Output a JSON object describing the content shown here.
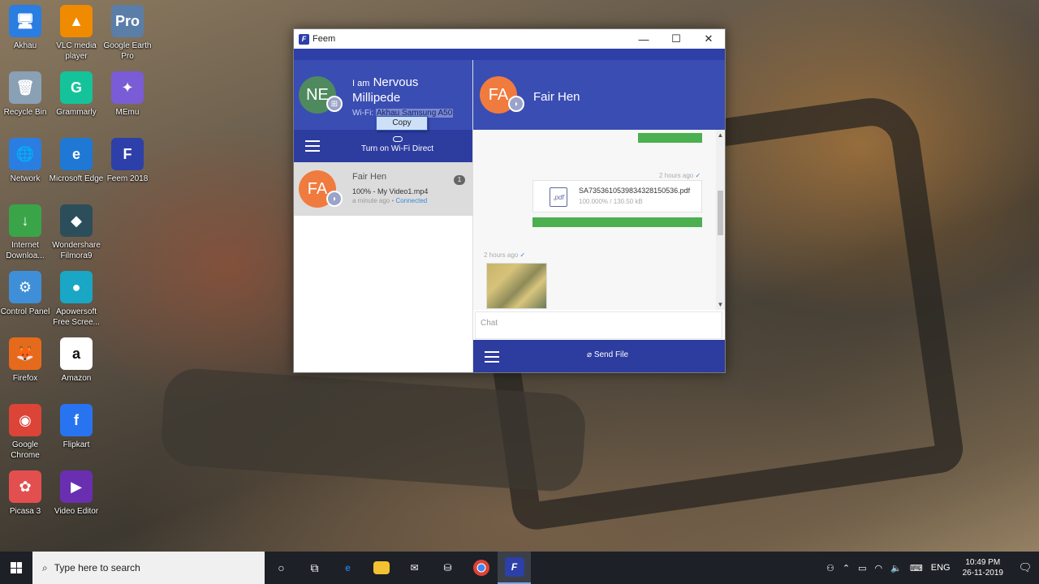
{
  "desktop": {
    "icons": [
      {
        "label": "Akhau",
        "glyph": "🖥",
        "color": "#2a7de1"
      },
      {
        "label": "VLC media player",
        "glyph": "▲",
        "color": "#f08a00"
      },
      {
        "label": "Google Earth Pro",
        "glyph": "Pro",
        "color": "#5b7ea8"
      },
      {
        "label": "Recycle Bin",
        "glyph": "🗑",
        "color": "#8aa0b5"
      },
      {
        "label": "Grammarly",
        "glyph": "G",
        "color": "#15c39a"
      },
      {
        "label": "MEmu",
        "glyph": "✦",
        "color": "#7a5cd6"
      },
      {
        "label": "Network",
        "glyph": "🌐",
        "color": "#2a7de1"
      },
      {
        "label": "Microsoft Edge",
        "glyph": "e",
        "color": "#1e78d4"
      },
      {
        "label": "Feem 2018",
        "glyph": "F",
        "color": "#2d3fa8"
      },
      {
        "label": "Internet Downloa...",
        "glyph": "↓",
        "color": "#3aa548"
      },
      {
        "label": "Wondershare Filmora9",
        "glyph": "◆",
        "color": "#2b4e5a"
      },
      {
        "label": "Control Panel",
        "glyph": "⚙",
        "color": "#3f8fd8"
      },
      {
        "label": "Apowersoft Free Scree...",
        "glyph": "●",
        "color": "#19a7c5"
      },
      {
        "label": "Firefox",
        "glyph": "🦊",
        "color": "#e66a1c"
      },
      {
        "label": "Amazon",
        "glyph": "a",
        "color": "#ffffff"
      },
      {
        "label": "Google Chrome",
        "glyph": "◉",
        "color": "#db4437"
      },
      {
        "label": "Flipkart",
        "glyph": "f",
        "color": "#2874f0"
      },
      {
        "label": "Picasa 3",
        "glyph": "✿",
        "color": "#e34f4f"
      },
      {
        "label": "Video Editor",
        "glyph": "▶",
        "color": "#6a2fb1"
      }
    ]
  },
  "window": {
    "title": "Feem",
    "minimize": "—",
    "maximize": "☐",
    "close": "✕"
  },
  "me": {
    "initials": "NE",
    "avatar_color": "#4f8a5e",
    "prefix": "I am",
    "name": "Nervous Millipede",
    "wifi_label": "Wi-Fi:",
    "wifi_name": "Akhau Samsung A50",
    "copy_menu": "Copy"
  },
  "left_bar": {
    "wifi_direct": "Turn on Wi-Fi Direct"
  },
  "peers": [
    {
      "initials": "FA",
      "avatar_color": "#f07b3f",
      "name": "Fair Hen",
      "last_file": "100% - My Video1.mp4",
      "time": "a minute ago",
      "sep": " • ",
      "status": "Connected",
      "unread": "1"
    }
  ],
  "chat": {
    "peer_initials": "FA",
    "peer_name": "Fair Hen",
    "messages": [
      {
        "type": "progress",
        "progress": 1.0
      },
      {
        "type": "file",
        "time": "2 hours ago",
        "check": "✓",
        "ext": ".pdf",
        "filename": "SA735361053983432815053​6.pdf",
        "status": "100.000% / 130.50 kB",
        "progress": 1.0
      },
      {
        "type": "image",
        "time": "2 hours ago",
        "check": "✓"
      }
    ],
    "input_placeholder": "Chat",
    "send_file": "Send File"
  },
  "taskbar": {
    "search_placeholder": "Type here to search",
    "time": "10:49 PM",
    "date": "26-11-2019",
    "lang": "ENG"
  }
}
